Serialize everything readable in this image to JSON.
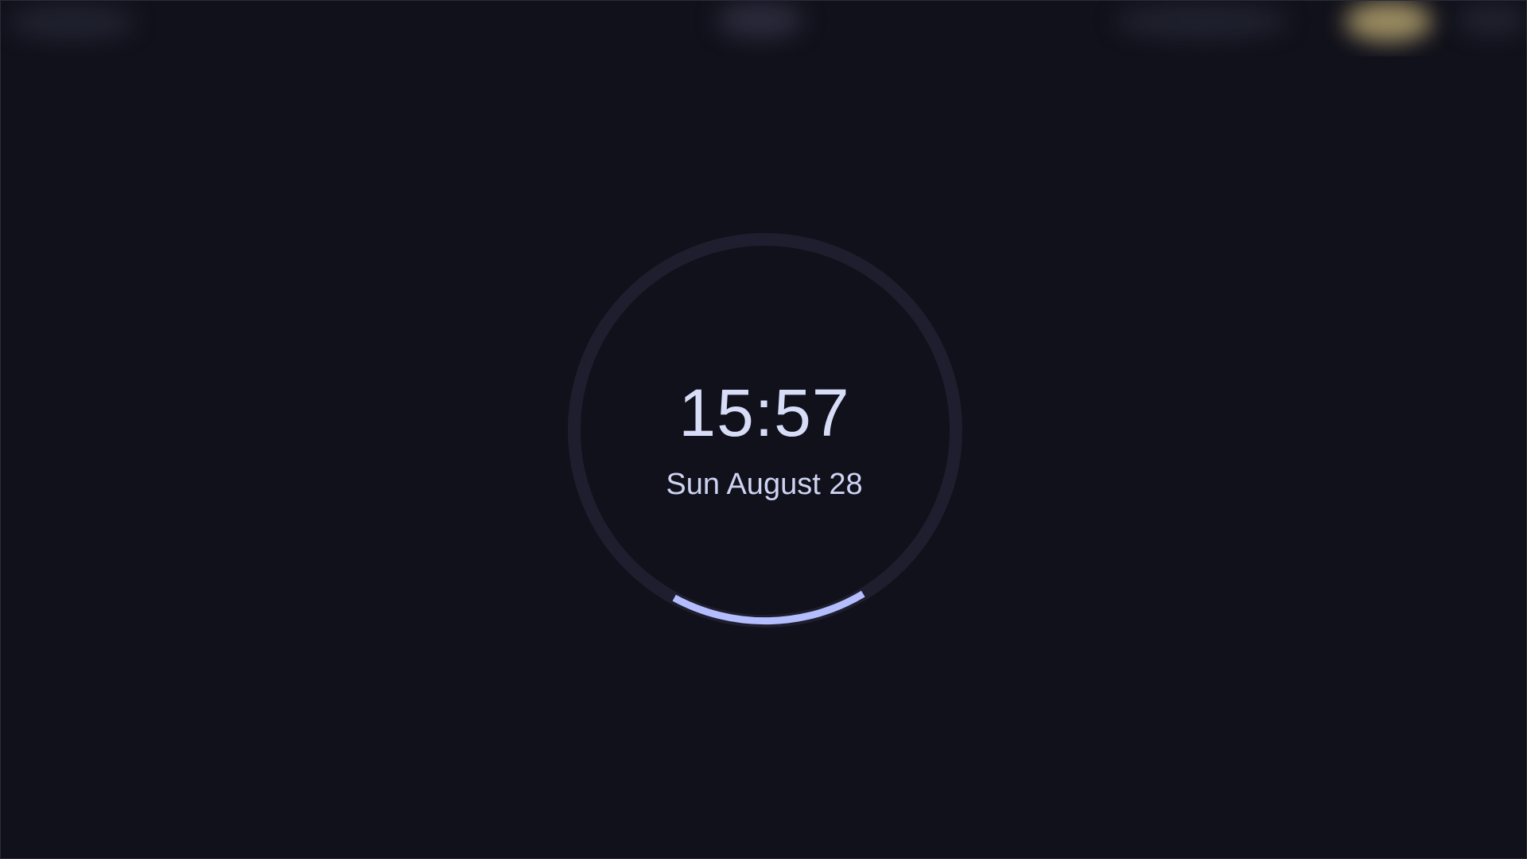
{
  "lockscreen": {
    "time": "15:57",
    "date": "Sun August 28"
  },
  "colors": {
    "background": "#11111b",
    "ring_track": "#1e1e2e",
    "ring_accent": "#b4befe",
    "text": "#cdd6f4"
  }
}
